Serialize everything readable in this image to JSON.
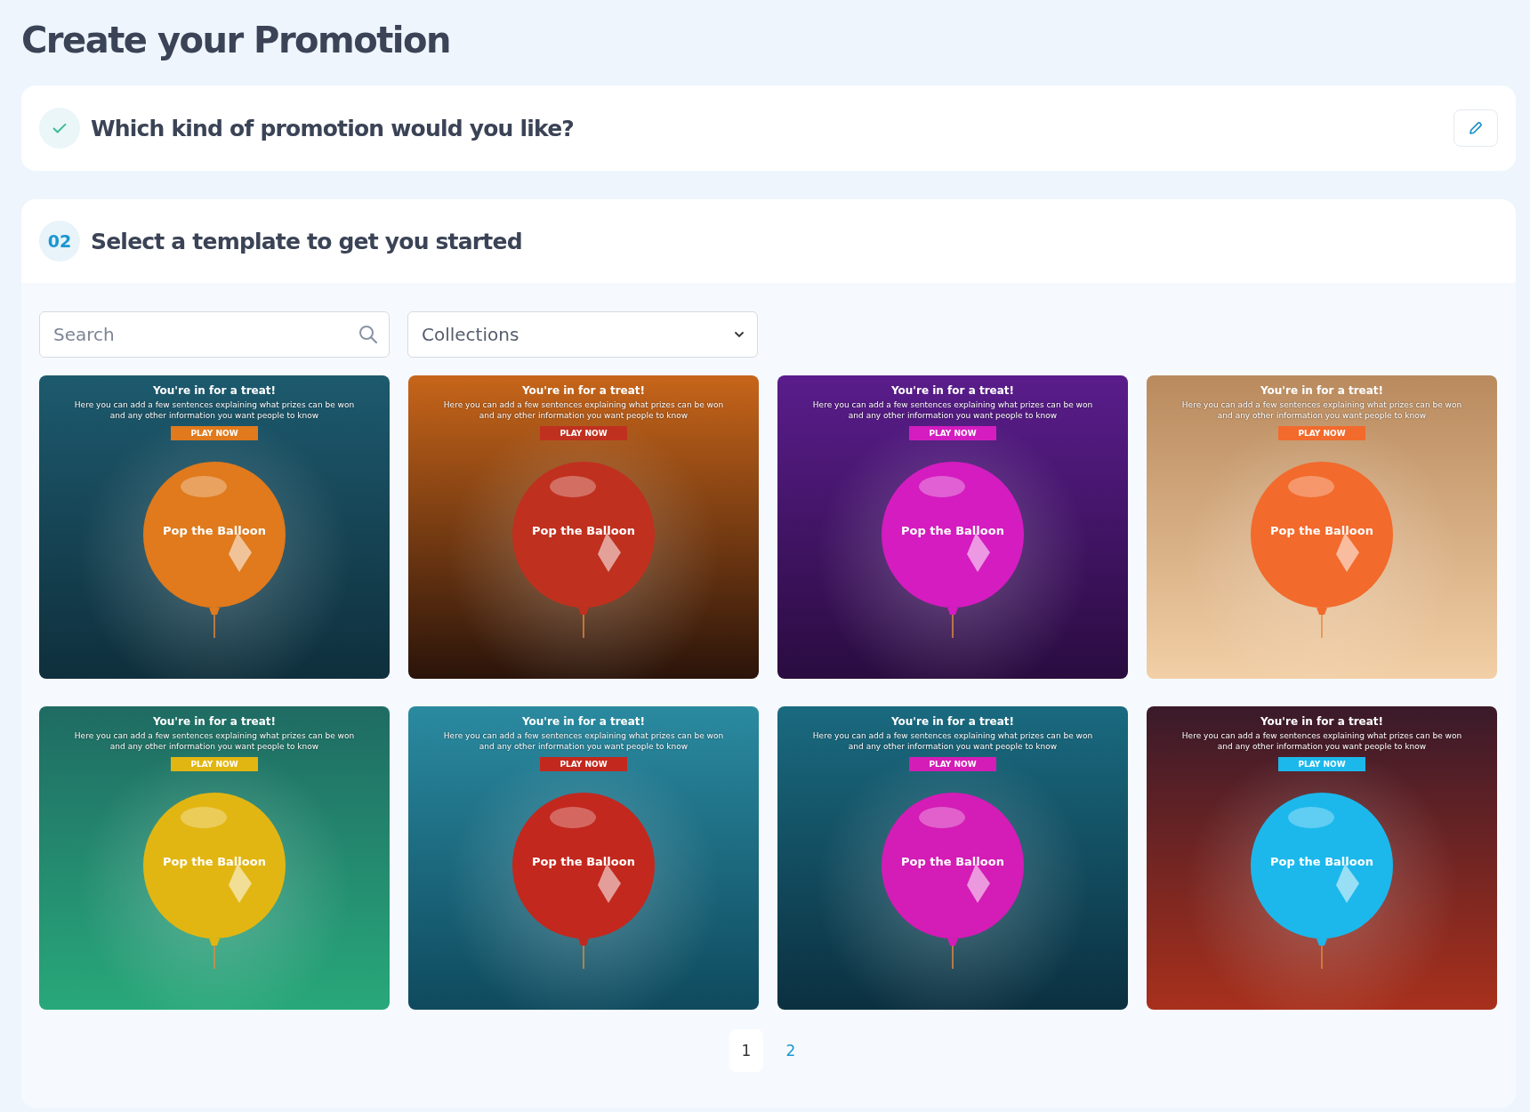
{
  "page_title": "Create your Promotion",
  "step_1": {
    "title": "Which kind of promotion would you like?",
    "completed": true
  },
  "step_2": {
    "number": "02",
    "title": "Select a template to get you started",
    "search": {
      "placeholder": "Search"
    },
    "collections": {
      "value": "Collections"
    },
    "templates": [
      {
        "title": "You're in for a treat!",
        "body": "Here you can add a few sentences explaining what prizes can be won and any other information you want people to know",
        "button": "PLAY NOW",
        "balloon_label": "Pop the Balloon",
        "color": "#e07a1c"
      },
      {
        "title": "You're in for a treat!",
        "body": "Here you can add a few sentences explaining what prizes can be won and any other information you want people to know",
        "button": "PLAY NOW",
        "balloon_label": "Pop the Balloon",
        "color": "#c0301f"
      },
      {
        "title": "You're in for a treat!",
        "body": "Here you can add a few sentences explaining what prizes can be won and any other information you want people to know",
        "button": "PLAY NOW",
        "balloon_label": "Pop the Balloon",
        "color": "#d41cc0"
      },
      {
        "title": "You're in for a treat!",
        "body": "Here you can add a few sentences explaining what prizes can be won and any other information you want people to know",
        "button": "PLAY NOW",
        "balloon_label": "Pop the Balloon",
        "color": "#f26a2c"
      },
      {
        "title": "You're in for a treat!",
        "body": "Here you can add a few sentences explaining what prizes can be won and any other information you want people to know",
        "button": "PLAY NOW",
        "balloon_label": "Pop the Balloon",
        "color": "#e2b612"
      },
      {
        "title": "You're in for a treat!",
        "body": "Here you can add a few sentences explaining what prizes can be won and any other information you want people to know",
        "button": "PLAY NOW",
        "balloon_label": "Pop the Balloon",
        "color": "#c2281e"
      },
      {
        "title": "You're in for a treat!",
        "body": "Here you can add a few sentences explaining what prizes can be won and any other information you want people to know",
        "button": "PLAY NOW",
        "balloon_label": "Pop the Balloon",
        "color": "#d41cb6"
      },
      {
        "title": "You're in for a treat!",
        "body": "Here you can add a few sentences explaining what prizes can be won and any other information you want people to know",
        "button": "PLAY NOW",
        "balloon_label": "Pop the Balloon",
        "color": "#1cb8ec"
      }
    ],
    "pagination": [
      {
        "label": "1",
        "selected": true
      },
      {
        "label": "2",
        "selected": false
      }
    ]
  }
}
